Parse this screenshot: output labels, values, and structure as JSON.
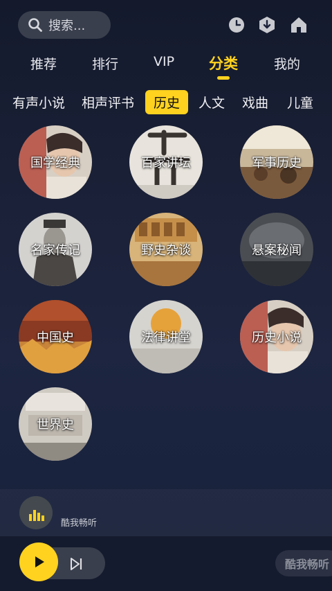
{
  "search": {
    "placeholder": "搜索..."
  },
  "top_icons": [
    "clock-icon",
    "download-icon",
    "home-icon"
  ],
  "main_tabs": [
    {
      "label": "推荐"
    },
    {
      "label": "排行"
    },
    {
      "label": "VIP"
    },
    {
      "label": "分类",
      "active": true
    },
    {
      "label": "我的"
    }
  ],
  "sub_tabs": [
    {
      "label": "有声小说"
    },
    {
      "label": "相声评书"
    },
    {
      "label": "历史",
      "active": true
    },
    {
      "label": "人文"
    },
    {
      "label": "戏曲"
    },
    {
      "label": "儿童"
    }
  ],
  "categories": [
    {
      "label": "国学经典"
    },
    {
      "label": "百家讲坛"
    },
    {
      "label": "军事历史"
    },
    {
      "label": "名家传记"
    },
    {
      "label": "野史杂谈"
    },
    {
      "label": "悬案秘闻"
    },
    {
      "label": "中国史"
    },
    {
      "label": "法律讲堂"
    },
    {
      "label": "历史小说"
    },
    {
      "label": "世界史"
    }
  ],
  "mini_player": {
    "title": "酷我畅听"
  },
  "brand_button": {
    "label": "酷我畅听"
  },
  "colors": {
    "accent": "#ffd21f",
    "background": "#1b2138"
  }
}
